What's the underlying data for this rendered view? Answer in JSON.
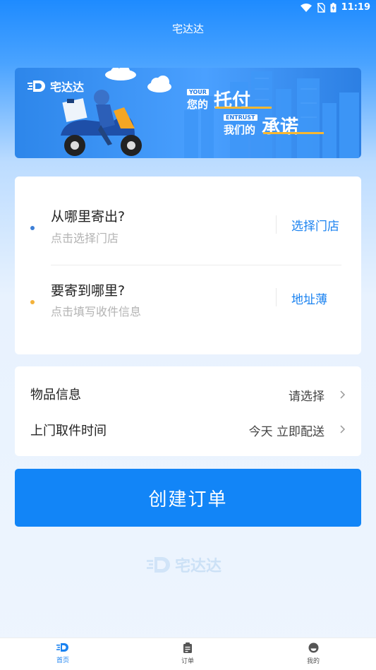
{
  "status_bar": {
    "time": "11:19"
  },
  "header": {
    "title": "宅达达"
  },
  "banner": {
    "brand": "宅达达",
    "tag_your": "YOUR",
    "line1_prefix": "您的",
    "line1_main": "托付",
    "tag_entrust": "ENTRUST",
    "line2_prefix": "我们的",
    "line2_main": "承诺"
  },
  "sender": {
    "title": "从哪里寄出?",
    "hint": "点击选择门店",
    "action": "选择门店",
    "dot_color": "#3d7fd6"
  },
  "receiver": {
    "title": "要寄到哪里?",
    "hint": "点击填写收件信息",
    "action": "地址薄",
    "dot_color": "#f3b23a"
  },
  "details": [
    {
      "label": "物品信息",
      "value": "请选择"
    },
    {
      "label": "上门取件时间",
      "value": "今天 立即配送"
    }
  ],
  "create_button": "创建订单",
  "watermark": "宅达达",
  "tabs": [
    {
      "label": "首页",
      "icon": "home-logo-icon",
      "active": true
    },
    {
      "label": "订单",
      "icon": "clipboard-icon",
      "active": false
    },
    {
      "label": "我的",
      "icon": "profile-icon",
      "active": false
    }
  ]
}
